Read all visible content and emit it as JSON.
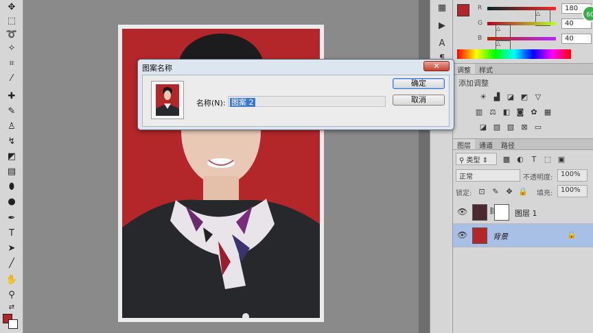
{
  "dialog": {
    "title": "图案名称",
    "close_label": "✕",
    "name_label": "名称(N):",
    "name_value": "图案 2",
    "ok_label": "确定",
    "cancel_label": "取消"
  },
  "color_panel": {
    "r_label": "R",
    "g_label": "G",
    "b_label": "B",
    "r_value": "180",
    "g_value": "40",
    "b_value": "40",
    "foreground_color": "#b4282a"
  },
  "adjustments": {
    "tabs": [
      "调整",
      "样式"
    ],
    "title": "添加调整"
  },
  "layers": {
    "tabs": [
      "图层",
      "通道",
      "路径"
    ],
    "filter_label": "类型",
    "blend_mode": "正常",
    "opacity_label": "不透明度:",
    "opacity_value": "100%",
    "lock_label": "锁定:",
    "fill_label": "填充:",
    "fill_value": "100%",
    "items": [
      {
        "name": "图层 1"
      },
      {
        "name": "背景"
      }
    ]
  },
  "badge": "60"
}
